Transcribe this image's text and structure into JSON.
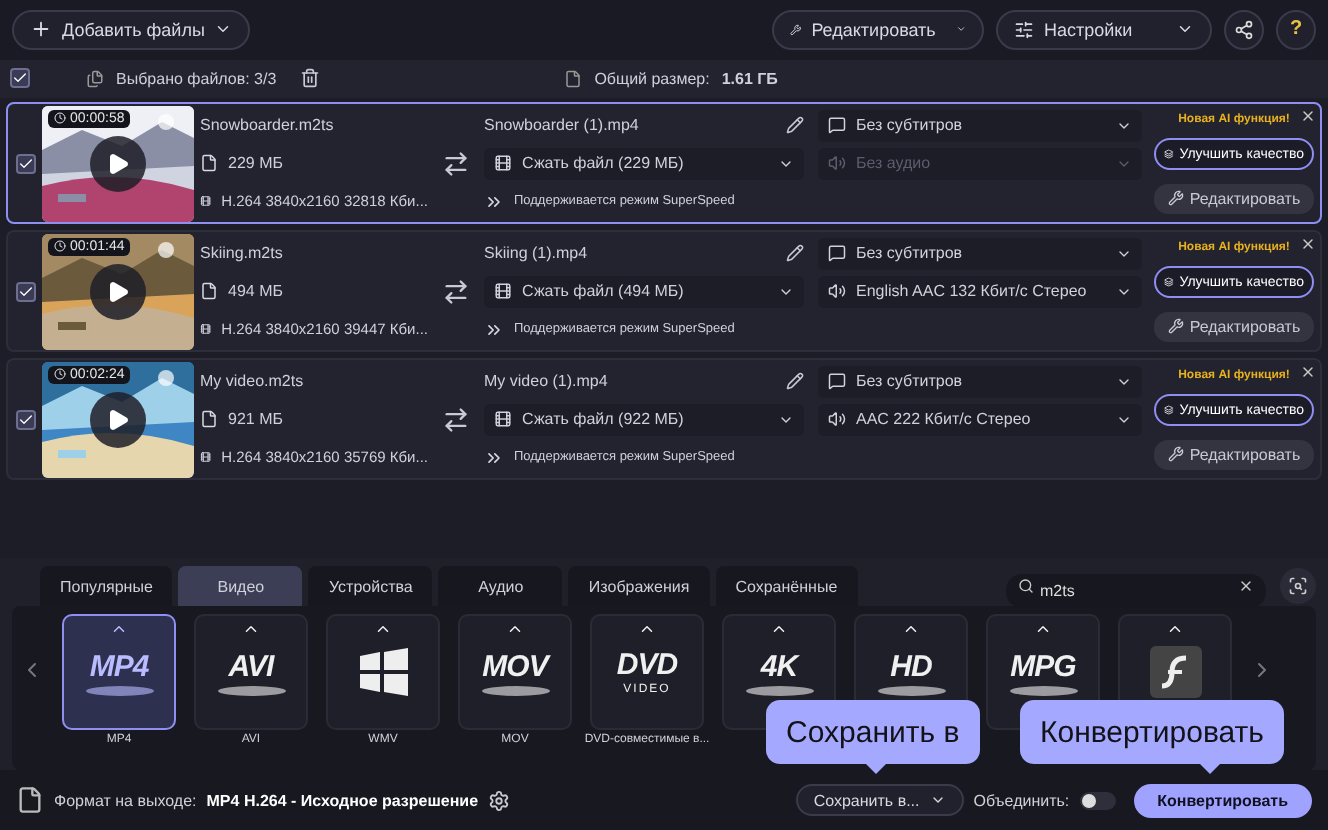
{
  "toolbar": {
    "add_files": "Добавить файлы",
    "edit": "Редактировать",
    "settings": "Настройки",
    "help": "?"
  },
  "selection_bar": {
    "all_checked": true,
    "selected": "Выбрано файлов: 3/3",
    "total_label": "Общий размер:",
    "total_value": "1.61 ГБ"
  },
  "files": [
    {
      "checked": true,
      "selected": true,
      "duration": "00:00:58",
      "name": "Snowboarder.m2ts",
      "size": "229 МБ",
      "codec": "H.264 3840x2160 32818 Кби...",
      "output_name": "Snowboarder (1).mp4",
      "compression": "Сжать файл (229 МБ)",
      "superspeed": "Поддерживается режим SuperSpeed",
      "subtitles": "Без субтитров",
      "audio": "Без аудио",
      "audio_disabled": true,
      "ai_label": "Новая AI функция!",
      "enhance": "Улучшить качество",
      "edit": "Редактировать"
    },
    {
      "checked": true,
      "selected": false,
      "duration": "00:01:44",
      "name": "Skiing.m2ts",
      "size": "494 МБ",
      "codec": "H.264 3840x2160 39447 Кби...",
      "output_name": "Skiing (1).mp4",
      "compression": "Сжать файл (494 МБ)",
      "superspeed": "Поддерживается режим SuperSpeed",
      "subtitles": "Без субтитров",
      "audio": "English AAC 132 Кбит/с Стерео",
      "audio_disabled": false,
      "ai_label": "Новая AI функция!",
      "enhance": "Улучшить качество",
      "edit": "Редактировать"
    },
    {
      "checked": true,
      "selected": false,
      "duration": "00:02:24",
      "name": "My video.m2ts",
      "size": "921 МБ",
      "codec": "H.264 3840x2160 35769 Кби...",
      "output_name": "My video (1).mp4",
      "compression": "Сжать файл (922 МБ)",
      "superspeed": "Поддерживается режим SuperSpeed",
      "subtitles": "Без субтитров",
      "audio": "AAC 222 Кбит/с Стерео",
      "audio_disabled": false,
      "ai_label": "Новая AI функция!",
      "enhance": "Улучшить качество",
      "edit": "Редактировать"
    }
  ],
  "format_tabs": [
    {
      "label": "Популярные",
      "selected": false
    },
    {
      "label": "Видео",
      "selected": true
    },
    {
      "label": "Устройства",
      "selected": false
    },
    {
      "label": "Аудио",
      "selected": false
    },
    {
      "label": "Изображения",
      "selected": false
    },
    {
      "label": "Сохранённые",
      "selected": false
    }
  ],
  "format_search": {
    "value": "m2ts"
  },
  "formats": [
    {
      "kind": "logo",
      "logo": "MP4",
      "label": "MP4",
      "selected": true
    },
    {
      "kind": "logo",
      "logo": "AVI",
      "label": "AVI",
      "selected": false
    },
    {
      "kind": "windows",
      "label": "WMV",
      "selected": false
    },
    {
      "kind": "logo",
      "logo": "MOV",
      "label": "MOV",
      "selected": false
    },
    {
      "kind": "logo",
      "logo": "DVD",
      "sub": "VIDEO",
      "label": "DVD-совместимые в...",
      "selected": false
    },
    {
      "kind": "logo",
      "logo": "4K",
      "selected": false
    },
    {
      "kind": "logo",
      "logo": "HD",
      "selected": false
    },
    {
      "kind": "logo",
      "logo": "MPG",
      "selected": false
    },
    {
      "kind": "flash",
      "selected": false
    }
  ],
  "bottom_bar": {
    "output_label": "Формат на выходе:",
    "output_value": "MP4 H.264 - Исходное разрешение",
    "save_to": "Сохранить в...",
    "merge_label": "Объединить:",
    "merge_on": false,
    "convert": "Конвертировать"
  },
  "callouts": [
    "Сохранить в",
    "Конвертировать"
  ]
}
